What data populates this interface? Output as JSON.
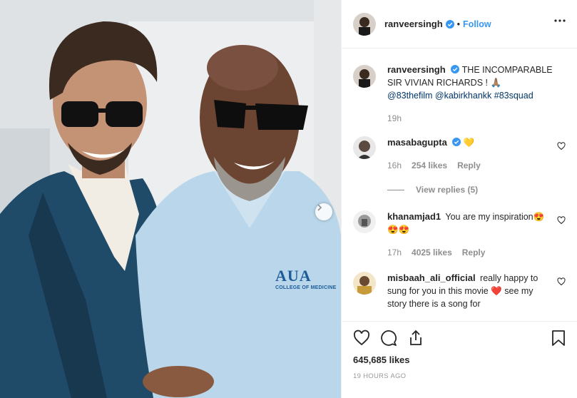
{
  "post": {
    "username": "ranveersingh",
    "follow_label": "Follow",
    "dot": "•",
    "caption": {
      "username": "ranveersingh",
      "text": "THE INCOMPARABLE SIR VIVIAN RICHARDS ! 🙏🏽",
      "mentions": "@83thefilm @kabirkhankk #83squad",
      "time": "19h"
    },
    "shirt_logo": "AUA",
    "shirt_logo_sub": "COLLEGE OF MEDICINE"
  },
  "comments": [
    {
      "username": "masabagupta",
      "verified": true,
      "text": "💛",
      "time": "16h",
      "likes": "254 likes",
      "reply": "Reply",
      "view_replies": "View replies (5)"
    },
    {
      "username": "khanamjad1",
      "verified": false,
      "text": "You are my inspiration😍😍😍",
      "time": "17h",
      "likes": "4025 likes",
      "reply": "Reply"
    },
    {
      "username": "misbaah_ali_official",
      "verified": false,
      "text": "really happy to sung for you in this movie ❤️ see my story there is a song for"
    }
  ],
  "footer": {
    "likes": "645,685 likes",
    "time_ago": "19 HOURS AGO"
  },
  "colors": {
    "link": "#003569",
    "follow": "#3897f0",
    "muted": "#8e8e8e",
    "verified": "#3897f0"
  }
}
